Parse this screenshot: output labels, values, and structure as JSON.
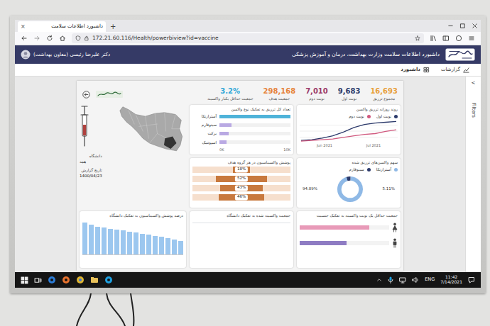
{
  "browser": {
    "tab_title": "داشبورد اطلاعات سلامت",
    "tab_close": "×",
    "new_tab": "+",
    "url": "172.21.60.116/Health/powerbiview?id=vaccine"
  },
  "header": {
    "title": "داشبورد اطلاعات سلامت وزارت بهداشت، درمان و آموزش پزشکی",
    "user": "دکتر علیرضا رئیسی (معاون بهداشت)"
  },
  "nav": [
    {
      "label": "گزارشات",
      "selected": false
    },
    {
      "label": "داشبورد",
      "selected": true
    }
  ],
  "filters_pane": {
    "arrow": "<",
    "label": "Filters"
  },
  "kpis": [
    {
      "value": "16,693",
      "label": "مجموع تزریق",
      "color": "#e8a13a"
    },
    {
      "value": "9,683",
      "label": "نوبت اول",
      "color": "#2c3a6b"
    },
    {
      "value": "7,010",
      "label": "نوبت دوم",
      "color": "#9b3a6b"
    },
    {
      "value": "298,168",
      "label": "جمعیت هدف",
      "color": "#e6833a"
    },
    {
      "value": "3.2%",
      "label": "جمعیت حداقل یکبار واکسینه",
      "color": "#2ea7d8"
    }
  ],
  "slicers": [
    {
      "label": "دانشگاه",
      "value": "همه"
    },
    {
      "label": "تاریخ گزارش",
      "value": "1400/04/23"
    }
  ],
  "bar_chart": {
    "title": "تعداد کل تزریق به تفکیک نوع واکسن",
    "bars": [
      {
        "label": "آسترازنکا",
        "value": 8900,
        "color": "#4fb3d9"
      },
      {
        "label": "سینوفارم",
        "value": 1500,
        "color": "#b9a9e3"
      },
      {
        "label": "برکت",
        "value": 1200,
        "color": "#b9a9e3"
      },
      {
        "label": "اسپوتنیک",
        "value": 900,
        "color": "#b9a9e3"
      }
    ],
    "ticks": [
      "0K",
      "10K"
    ]
  },
  "line_chart": {
    "title": "روند روزانه تزریق واکسن",
    "series": [
      {
        "label": "نوبت اول",
        "color": "#2c3a6b",
        "values": [
          2,
          3,
          5,
          8,
          13,
          19,
          23,
          25,
          26,
          27
        ]
      },
      {
        "label": "نوبت دوم",
        "color": "#d0587e",
        "values": [
          1,
          2,
          3,
          4,
          6,
          8,
          10,
          11,
          14,
          16
        ]
      }
    ],
    "ticks": [
      "Jun 2021",
      "Jul 2021"
    ]
  },
  "funnel": {
    "title": "پوشش واکسیناسیون در هر گروه هدف",
    "rows": [
      {
        "value": "18%",
        "level": 0.18
      },
      {
        "value": "52%",
        "level": 0.52
      },
      {
        "value": "43%",
        "level": 0.43
      },
      {
        "value": "46%",
        "level": 0.46
      }
    ]
  },
  "donut": {
    "title": "سهم واکسن‌های تزریق شده",
    "segments": [
      {
        "label": "آسترازنکا",
        "value": 94.89,
        "reading": "94.89%",
        "color": "#8fb9e6"
      },
      {
        "label": "سینوفارم",
        "value": 5.11,
        "reading": "5.11%",
        "color": "#2c3a6b"
      }
    ]
  },
  "column_chart": {
    "title": "درصد پوشش واکسیناسیون به تفکیک دانشگاه",
    "values": [
      60,
      56,
      52,
      50,
      48,
      46,
      45,
      43,
      41,
      39,
      37,
      35,
      33,
      30,
      28,
      25
    ]
  },
  "university_card": {
    "title": "جمعیت واکسینه شده به تفکیک دانشگاه"
  },
  "gender_chart": {
    "title": "جمعیت حداقل یک نوبت واکسینه به تفکیک جنسیت",
    "rows": [
      {
        "level": 0.78,
        "color": "#e89ab8"
      },
      {
        "level": 0.52,
        "color": "#8e7cc3"
      }
    ]
  },
  "taskbar": {
    "lang": "ENG",
    "time": "11:42",
    "date": "7/14/2021"
  }
}
